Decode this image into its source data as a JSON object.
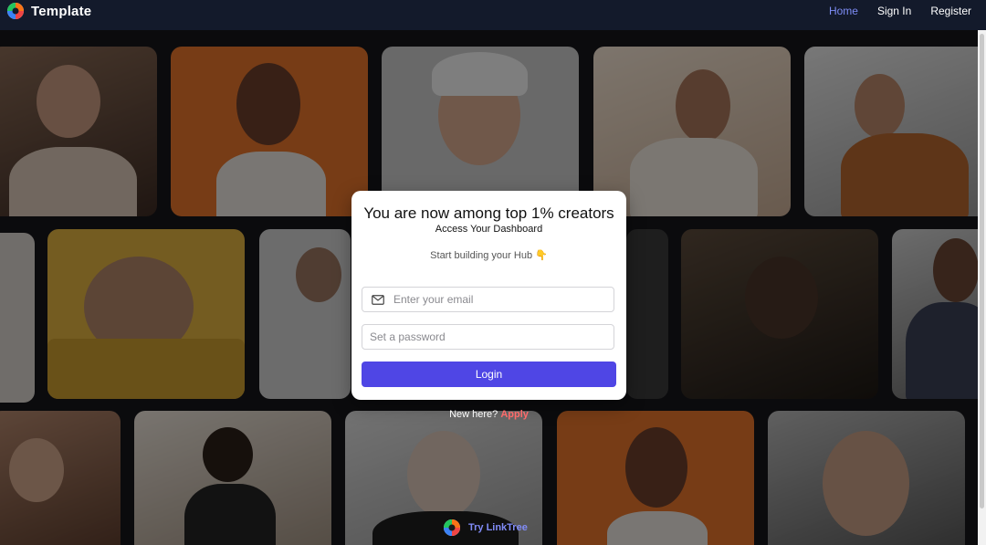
{
  "nav": {
    "brand": "Template",
    "links": [
      "Home",
      "Sign In",
      "Register"
    ]
  },
  "card": {
    "title": "You are now among top 1% creators",
    "subtitle": "Access Your Dashboard",
    "hint": "Start building your Hub 👇",
    "email_placeholder": "Enter your email",
    "password_placeholder": "Set a password",
    "login_label": "Login"
  },
  "footer": {
    "new_here": "New here?",
    "apply": "Apply",
    "try_label": "Try LinkTree"
  },
  "colors": {
    "accent": "#4f46e5",
    "apply": "#ff6b6b",
    "nav_bg": "#131a2b",
    "nav_active": "#7d8cf5"
  },
  "icons": [
    "logo-icon",
    "mail-icon"
  ]
}
